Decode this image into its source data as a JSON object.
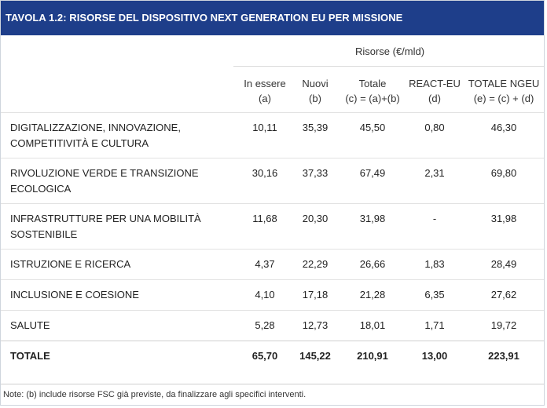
{
  "title": "TAVOLA 1.2: RISORSE DEL DISPOSITIVO NEXT GENERATION EU PER MISSIONE",
  "group_header": "Risorse (€/mld)",
  "columns": [
    {
      "line1": "In essere",
      "line2": "(a)"
    },
    {
      "line1": "Nuovi",
      "line2": "(b)"
    },
    {
      "line1": "Totale",
      "line2": "(c) = (a)+(b)"
    },
    {
      "line1": "REACT-EU",
      "line2": "(d)"
    },
    {
      "line1": "TOTALE NGEU",
      "line2": "(e) = (c) + (d)"
    }
  ],
  "rows": [
    {
      "label_1": "DIGITALIZZAZIONE, INNOVAZIONE,",
      "label_2": "COMPETITIVITÀ E CULTURA",
      "values": [
        "10,11",
        "35,39",
        "45,50",
        "0,80",
        "46,30"
      ]
    },
    {
      "label_1": "RIVOLUZIONE VERDE E TRANSIZIONE",
      "label_2": "ECOLOGICA",
      "values": [
        "30,16",
        "37,33",
        "67,49",
        "2,31",
        "69,80"
      ]
    },
    {
      "label_1": "INFRASTRUTTURE PER UNA MOBILITÀ",
      "label_2": "SOSTENIBILE",
      "values": [
        "11,68",
        "20,30",
        "31,98",
        "-",
        "31,98"
      ]
    },
    {
      "label_1": "ISTRUZIONE E RICERCA",
      "label_2": "",
      "values": [
        "4,37",
        "22,29",
        "26,66",
        "1,83",
        "28,49"
      ]
    },
    {
      "label_1": "INCLUSIONE E COESIONE",
      "label_2": "",
      "values": [
        "4,10",
        "17,18",
        "21,28",
        "6,35",
        "27,62"
      ]
    },
    {
      "label_1": "SALUTE",
      "label_2": "",
      "values": [
        "5,28",
        "12,73",
        "18,01",
        "1,71",
        "19,72"
      ]
    }
  ],
  "total_row": {
    "label": "TOTALE",
    "values": [
      "65,70",
      "145,22",
      "210,91",
      "13,00",
      "223,91"
    ]
  },
  "note": "Note: (b) include risorse FSC già previste, da finalizzare agli specifici interventi.",
  "colors": {
    "title_bar": "#1e3e8a",
    "title_text": "#ffffff"
  }
}
